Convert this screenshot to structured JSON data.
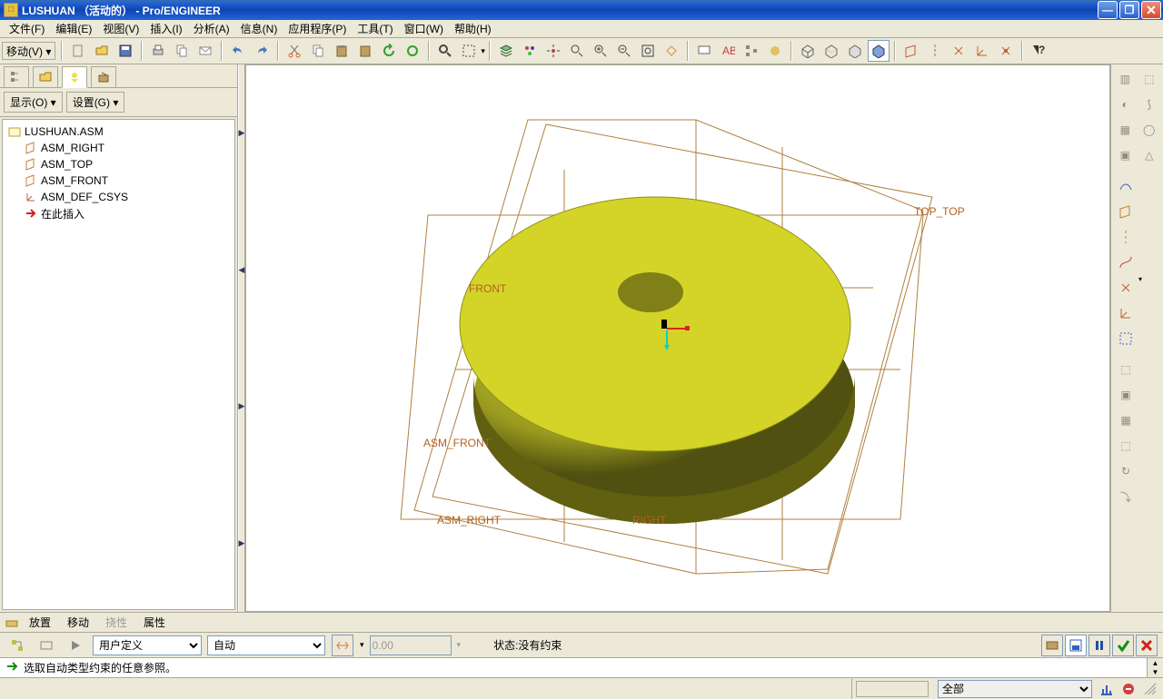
{
  "titlebar": {
    "title": "LUSHUAN （活动的） - Pro/ENGINEER"
  },
  "menu": {
    "items": [
      "文件(F)",
      "编辑(E)",
      "视图(V)",
      "插入(I)",
      "分析(A)",
      "信息(N)",
      "应用程序(P)",
      "工具(T)",
      "窗口(W)",
      "帮助(H)"
    ]
  },
  "toolbar": {
    "move_label": "移动(V) ▾"
  },
  "leftpanel": {
    "display_btn": "显示(O) ▾",
    "setting_btn": "设置(G) ▾",
    "root": "LUSHUAN.ASM",
    "items": [
      {
        "label": "ASM_RIGHT",
        "icon": "plane"
      },
      {
        "label": "ASM_TOP",
        "icon": "plane"
      },
      {
        "label": "ASM_FRONT",
        "icon": "plane"
      },
      {
        "label": "ASM_DEF_CSYS",
        "icon": "csys"
      },
      {
        "label": "在此插入",
        "icon": "arrow"
      }
    ]
  },
  "viewport": {
    "labels": {
      "top": "TOP_TOP",
      "front": "FRONT",
      "asm_front": "ASM_FRONT",
      "asm_right": "ASM_RIGHT",
      "right": "RIGHT"
    }
  },
  "dashboard": {
    "tabs": {
      "place": "放置",
      "move": "移动",
      "flex": "挠性",
      "prop": "属性"
    }
  },
  "controls": {
    "sel1": "用户定义",
    "sel2": "自动",
    "val": "0.00",
    "status_label": "状态:",
    "status": "没有约束"
  },
  "message": {
    "text": "选取自动类型约束的任意参照。"
  },
  "status": {
    "filter": "全部"
  }
}
